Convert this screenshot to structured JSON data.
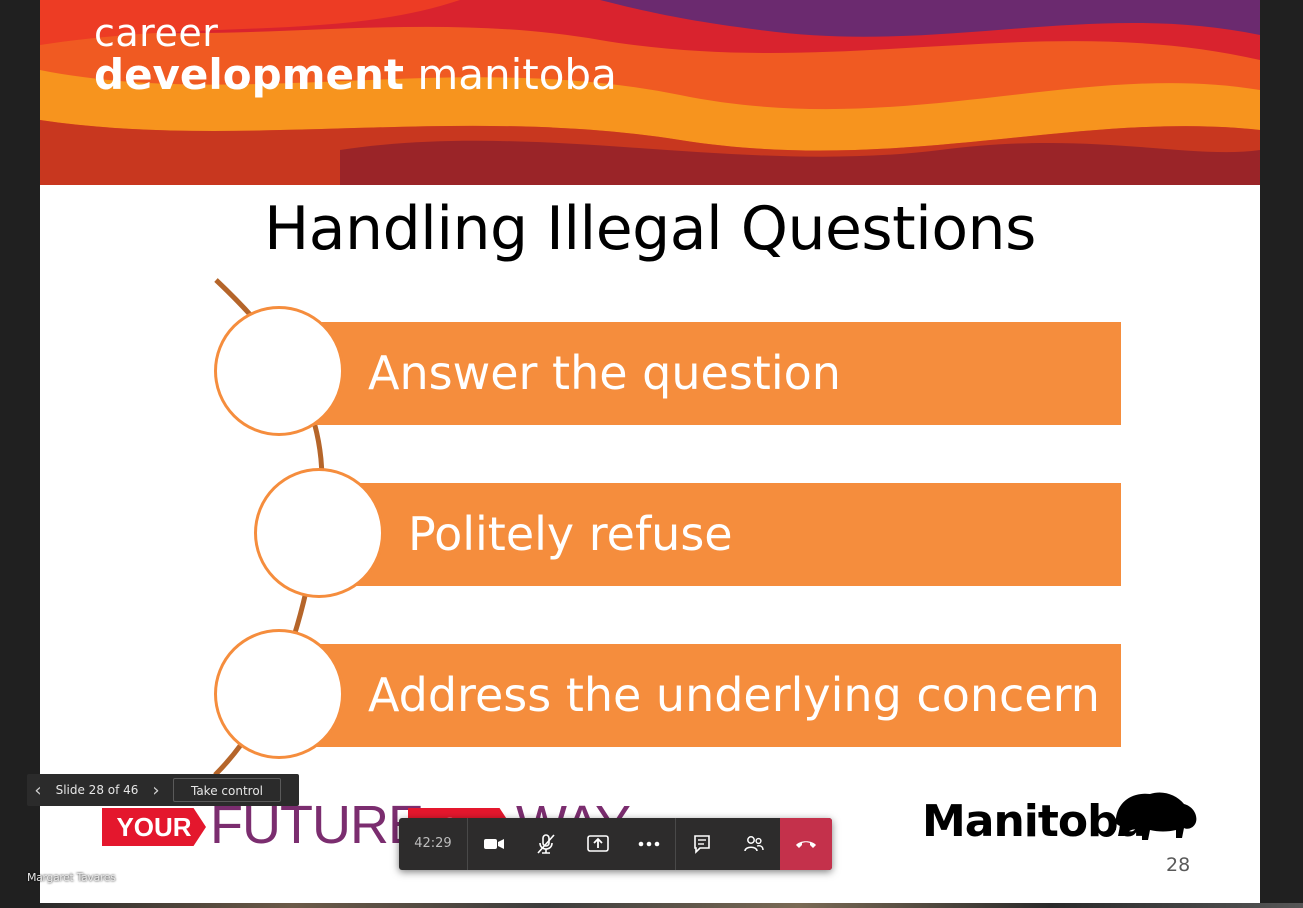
{
  "slide": {
    "brand_line1": "career",
    "brand_line2_bold": "development",
    "brand_line2_rest": " manitoba",
    "title": "Handling Illegal Questions",
    "items": [
      {
        "label": "Answer the question"
      },
      {
        "label": "Politely refuse"
      },
      {
        "label": "Address the underlying concern"
      }
    ],
    "footer_left_tag1": "YOUR",
    "footer_left_word1": "FUTURE",
    "footer_left_tag2": "YOUR",
    "footer_left_word2": "WAY",
    "footer_right_logo": "Manitoba",
    "page_number": "28"
  },
  "slide_nav": {
    "counter": "Slide 28 of 46",
    "take_control": "Take control"
  },
  "call_bar": {
    "timer": "42:29"
  },
  "presenter_name": "Margaret Tavares",
  "colors": {
    "accent_orange": "#f58d3d",
    "hangup_red": "#c4314b",
    "toolbar_bg": "#2d2c2c"
  }
}
